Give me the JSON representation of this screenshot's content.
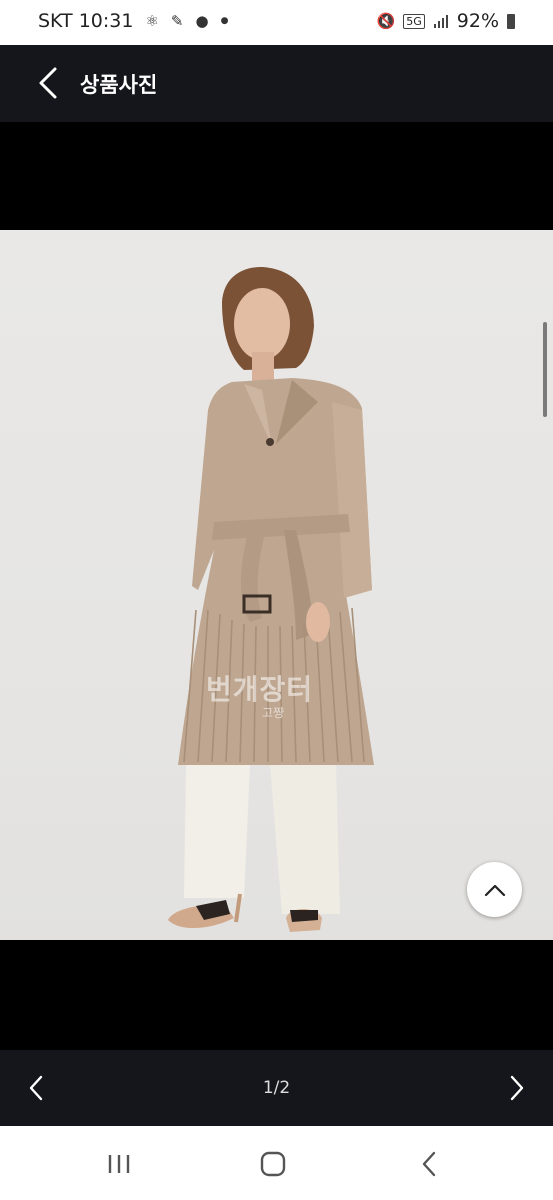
{
  "status_bar": {
    "carrier_time": "SKT 10:31",
    "network": "5G",
    "battery": "92%"
  },
  "header": {
    "title": "상품사진"
  },
  "photo": {
    "watermark": "번개장터",
    "watermark_sub": "고쨩"
  },
  "pager": {
    "counter": "1/2"
  },
  "colors": {
    "dark_bar": "#15151c",
    "photo_background": "#e7e6e4"
  }
}
